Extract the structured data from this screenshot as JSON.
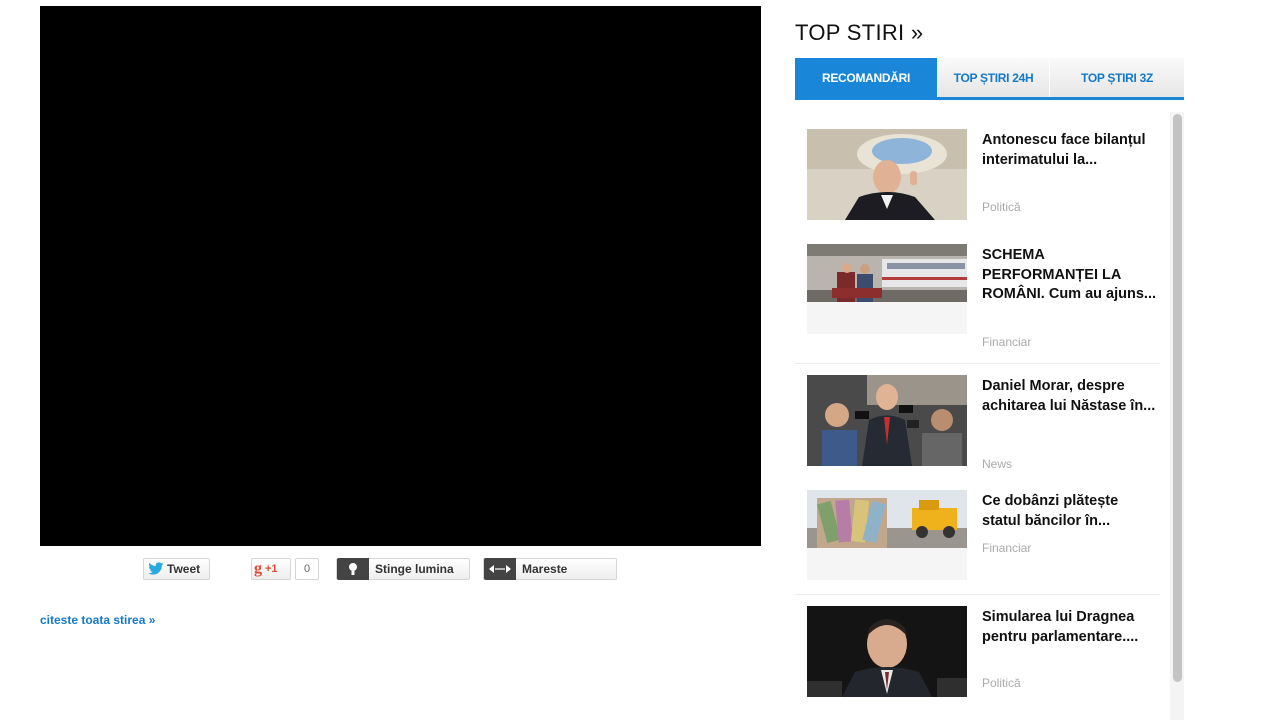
{
  "share": {
    "tweet_label": "Tweet",
    "gplus_label": "+1",
    "gplus_count": "0",
    "lights_label": "Stinge lumina",
    "enlarge_label": "Mareste"
  },
  "read_more": "citeste toata stirea »",
  "sidebar": {
    "title": "TOP STIRI »",
    "tabs": [
      {
        "label": "RECOMANDĂRI"
      },
      {
        "label": "TOP ȘTIRI 24H"
      },
      {
        "label": "TOP ȘTIRI 3Z"
      }
    ],
    "items": [
      {
        "title": "Antonescu face bilanțul interimatului la...",
        "category": "Politică"
      },
      {
        "title": "SCHEMA PERFORMANȚEI LA ROMÂNI. Cum au ajuns...",
        "category": "Financiar"
      },
      {
        "title": "Daniel Morar, despre achitarea lui Năstase în...",
        "category": "News"
      },
      {
        "title": "Ce dobânzi plătește statul băncilor în...",
        "category": "Financiar"
      },
      {
        "title": "Simularea lui Dragnea pentru parlamentare....",
        "category": "Politică"
      }
    ]
  },
  "colors": {
    "accent": "#1a86d8",
    "link": "#1479c6",
    "category": "#aaaaaa"
  }
}
